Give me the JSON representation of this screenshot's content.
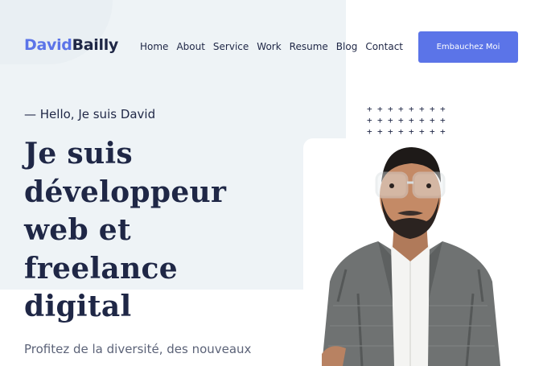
{
  "header": {
    "logo_first": "David",
    "logo_last": "Bailly",
    "nav": [
      "Home",
      "About",
      "Service",
      "Work",
      "Resume",
      "Blog",
      "Contact"
    ],
    "cta_label": "Embauchez Moi"
  },
  "hero": {
    "greeting": "— Hello, Je suis David",
    "headline_lines": [
      "Je suis",
      "développeur",
      "web et",
      "freelance",
      "digital"
    ],
    "intro": "Profitez de la diversité, des nouveaux"
  },
  "colors": {
    "accent": "#5b74e8",
    "dark": "#1f2746",
    "background_blob": "#eef3f6",
    "muted_text": "#5c6378"
  },
  "icons": [
    "plus-pattern-icon"
  ]
}
